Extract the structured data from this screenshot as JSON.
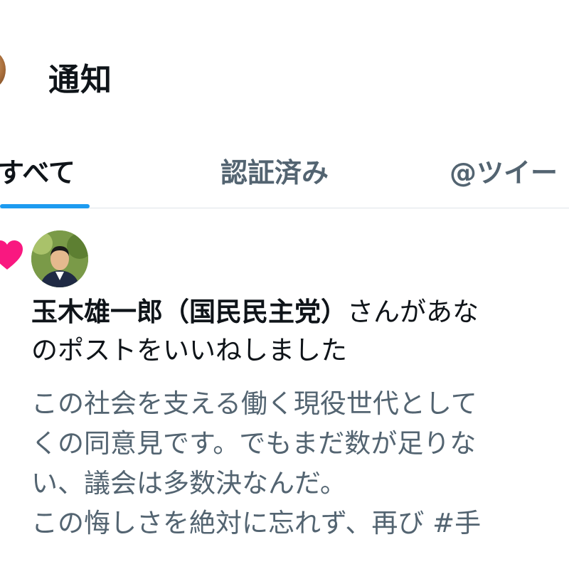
{
  "header": {
    "title": "通知"
  },
  "tabs": [
    {
      "label": "すべて",
      "active": true
    },
    {
      "label": "認証済み",
      "active": false
    },
    {
      "label": "@ツイー",
      "active": false
    }
  ],
  "notification": {
    "icon": "heart-icon",
    "user_name": "玉木雄一郎（国民民主党）",
    "action_line1": "さんがあな",
    "action_line2": "のポストをいいねしました",
    "body_lines": [
      "この社会を支える働く現役世代として",
      "くの同意見です。でもまだ数が足りな",
      "い、議会は多数決なんだ。",
      "この悔しさを絶対に忘れず、再び #手"
    ]
  },
  "colors": {
    "accent": "#1d9bf0",
    "like": "#f91880",
    "text_primary": "#0f1419",
    "text_secondary": "#536471"
  }
}
